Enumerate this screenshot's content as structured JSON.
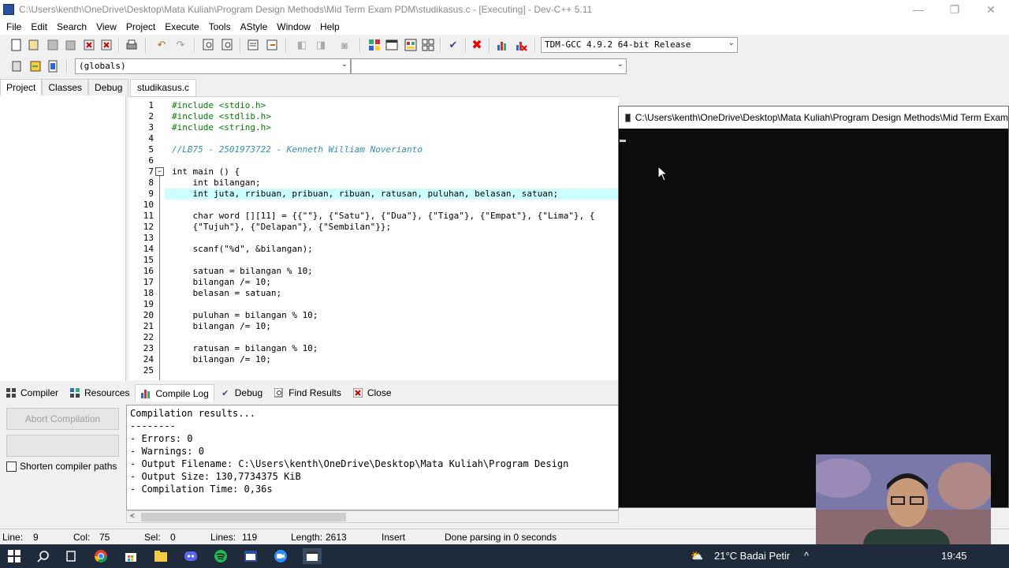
{
  "window": {
    "title": "C:\\Users\\kenth\\OneDrive\\Desktop\\Mata Kuliah\\Program Design Methods\\Mid Term Exam PDM\\studikasus.c - [Executing] - Dev-C++ 5.11"
  },
  "menu": [
    "File",
    "Edit",
    "Search",
    "View",
    "Project",
    "Execute",
    "Tools",
    "AStyle",
    "Window",
    "Help"
  ],
  "toolbar": {
    "compiler_select": "TDM-GCC 4.9.2 64-bit Release",
    "scope_select": "(globals)",
    "member_select": ""
  },
  "left_tabs": [
    "Project",
    "Classes",
    "Debug"
  ],
  "editor": {
    "file_tab": "studikasus.c",
    "current_line": 9,
    "lines": [
      {
        "n": "1",
        "text": "#include <stdio.h>"
      },
      {
        "n": "2",
        "text": "#include <stdlib.h>"
      },
      {
        "n": "3",
        "text": "#include <string.h>"
      },
      {
        "n": "4",
        "text": ""
      },
      {
        "n": "5",
        "text": "//LB75 - 2501973722 - Kenneth William Noverianto"
      },
      {
        "n": "6",
        "text": ""
      },
      {
        "n": "7",
        "text": "int main () {"
      },
      {
        "n": "8",
        "text": "    int bilangan;"
      },
      {
        "n": "9",
        "text": "    int juta, rribuan, pribuan, ribuan, ratusan, puluhan, belasan, satuan;"
      },
      {
        "n": "10",
        "text": ""
      },
      {
        "n": "11",
        "text": "    char word [][11] = {{\"\"}, {\"Satu\"}, {\"Dua\"}, {\"Tiga\"}, {\"Empat\"}, {\"Lima\"}, {"
      },
      {
        "n": "12",
        "text": "    {\"Tujuh\"}, {\"Delapan\"}, {\"Sembilan\"}};"
      },
      {
        "n": "13",
        "text": ""
      },
      {
        "n": "14",
        "text": "    scanf(\"%d\", &bilangan);"
      },
      {
        "n": "15",
        "text": ""
      },
      {
        "n": "16",
        "text": "    satuan = bilangan % 10;"
      },
      {
        "n": "17",
        "text": "    bilangan /= 10;"
      },
      {
        "n": "18",
        "text": "    belasan = satuan;"
      },
      {
        "n": "19",
        "text": ""
      },
      {
        "n": "20",
        "text": "    puluhan = bilangan % 10;"
      },
      {
        "n": "21",
        "text": "    bilangan /= 10;"
      },
      {
        "n": "22",
        "text": ""
      },
      {
        "n": "23",
        "text": "    ratusan = bilangan % 10;"
      },
      {
        "n": "24",
        "text": "    bilangan /= 10;"
      },
      {
        "n": "25",
        "text": ""
      }
    ]
  },
  "bottom_tabs": [
    "Compiler",
    "Resources",
    "Compile Log",
    "Debug",
    "Find Results",
    "Close"
  ],
  "bottom_active_tab": "Compile Log",
  "compile_panel": {
    "abort_button": "Abort Compilation",
    "shorten_paths_label": "Shorten compiler paths",
    "log": [
      "Compilation results...",
      "--------",
      "- Errors: 0",
      "- Warnings: 0",
      "- Output Filename: C:\\Users\\kenth\\OneDrive\\Desktop\\Mata Kuliah\\Program Design",
      "- Output Size: 130,7734375 KiB",
      "- Compilation Time: 0,36s"
    ]
  },
  "statusbar": {
    "line_label": "Line:",
    "line_value": "9",
    "col_label": "Col:",
    "col_value": "75",
    "sel_label": "Sel:",
    "sel_value": "0",
    "lines_label": "Lines:",
    "lines_value": "119",
    "length_label": "Length:",
    "length_value": "2613",
    "mode": "Insert",
    "message": "Done parsing in 0 seconds"
  },
  "console": {
    "title": "C:\\Users\\kenth\\OneDrive\\Desktop\\Mata Kuliah\\Program Design Methods\\Mid Term Exam"
  },
  "taskbar": {
    "weather": "21°C  Badai Petir",
    "time": "19:45"
  },
  "colors": {
    "current_line_bg": "#ccffff",
    "preprocessor": "#008000",
    "comment": "#2f8fbf",
    "string": "#0000ff",
    "number": "#800080",
    "symbol": "#ff0000",
    "taskbar_bg": "#1f2a3a",
    "console_bg": "#0c0c0c"
  }
}
